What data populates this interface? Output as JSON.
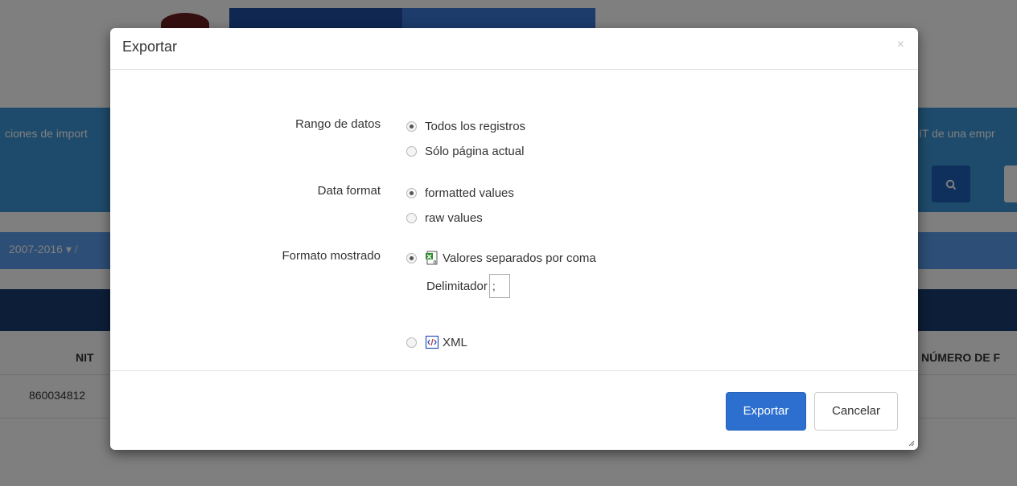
{
  "background": {
    "band_left_text": "ciones de import",
    "band_right_text": "IT de una empr",
    "search_icon": "search-icon",
    "breadcrumb_text": "2007-2016",
    "breadcrumb_sep": "/",
    "table": {
      "col_nit": "NIT",
      "col_numero": "NÚMERO DE F",
      "row1_nit": "860034812"
    }
  },
  "modal": {
    "title": "Exportar",
    "close_label": "×",
    "rango": {
      "label": "Rango de datos",
      "options": [
        "Todos los registros",
        "Sólo página actual"
      ],
      "selected": 0
    },
    "data_format": {
      "label": "Data format",
      "options": [
        "formatted values",
        "raw values"
      ],
      "selected": 0
    },
    "formato": {
      "label": "Formato mostrado",
      "options": [
        "Valores separados por coma",
        "XML"
      ],
      "option_icons": [
        "csv-file-icon",
        "xml-file-icon"
      ],
      "selected": 0,
      "delimiter_label": "Delimitador",
      "delimiter_value": ";"
    },
    "buttons": {
      "export_label": "Exportar",
      "cancel_label": "Cancelar"
    }
  },
  "colors": {
    "primary_button": "#2c6fcf",
    "band": "#3d97d6",
    "table_header": "#1a3c70"
  }
}
